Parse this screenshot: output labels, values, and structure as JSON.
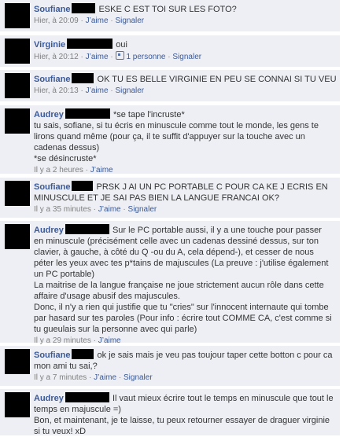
{
  "comments": [
    {
      "name": "Soufiane",
      "text": " ESKE C EST TOI SUR LES FOTO?",
      "time": "Hier, à 20:09",
      "like": "J’aime",
      "likes_count": "",
      "signal": "Signaler"
    },
    {
      "name": "Virginie",
      "text": " oui",
      "time": "Hier, à 20:12",
      "like": "J’aime",
      "likes_count": "1 personne",
      "signal": "Signaler"
    },
    {
      "name": "Soufiane",
      "text": " OK TU ES BELLE VIRGINIE EN PEU SE CONNAI SI TU VEU",
      "time": "Hier, à 20:13",
      "like": "J’aime",
      "likes_count": "",
      "signal": "Signaler"
    },
    {
      "name": "Audrey",
      "text": " *se tape l'incruste*",
      "body": "tu sais, sofiane, si tu écris en minuscule comme tout le monde, les gens te lirons quand même (pour ça, il te suffit d'appuyer sur la touche avec un cadenas dessus)\n*se désincruste*",
      "time": "Il y a 2 heures",
      "like": "J’aime",
      "likes_count": "",
      "signal": ""
    },
    {
      "name": "Soufiane",
      "text": " PRSK J AI UN PC PORTABLE C POUR CA KE J ECRIS EN MINUSCULE ET JE SAI PAS BIEN LA LANGUE FRANCAI OK?",
      "time": "Il y a 35 minutes",
      "like": "J’aime",
      "likes_count": "",
      "signal": "Signaler"
    },
    {
      "name": "Audrey",
      "text": " Sur le PC portable aussi, il y a une touche pour passer en minuscule (précisément celle avec un cadenas dessiné dessus, sur ton clavier, à gauche, à côté du Q -ou du A, cela dépend-), et cesser de nous péter les yeux avec tes p*tains de majuscules (La preuve : j'utilise également un PC portable)\nLa maitrise de la langue française ne joue strictement aucun rôle dans cette affaire d'usage abusif des majuscules.\nDonc, il n'y a rien qui justifie que tu \"cries\" sur l'innocent internaute qui tombe par hasard sur tes paroles (Pour info : écrire tout COMME CA, c'est comme si tu gueulais sur la personne avec qui parle)",
      "time": "Il y a 29 minutes",
      "like": "J’aime",
      "likes_count": "",
      "signal": ""
    },
    {
      "name": "Soufiane",
      "text": " ok je sais mais je veu pas toujour taper cette botton c pour ca mon ami tu sai,?",
      "time": "Il y a 7 minutes",
      "like": "J’aime",
      "likes_count": "",
      "signal": "Signaler"
    },
    {
      "name": "Audrey",
      "text": " Il vaut mieux écrire tout le temps en minuscule que tout le temps en majuscule =)\nBon, et maintenant, je te laisse, tu peux retourner essayer de draguer virginie si tu veux! xD",
      "time": "",
      "like": "",
      "likes_count": "",
      "signal": ""
    }
  ]
}
